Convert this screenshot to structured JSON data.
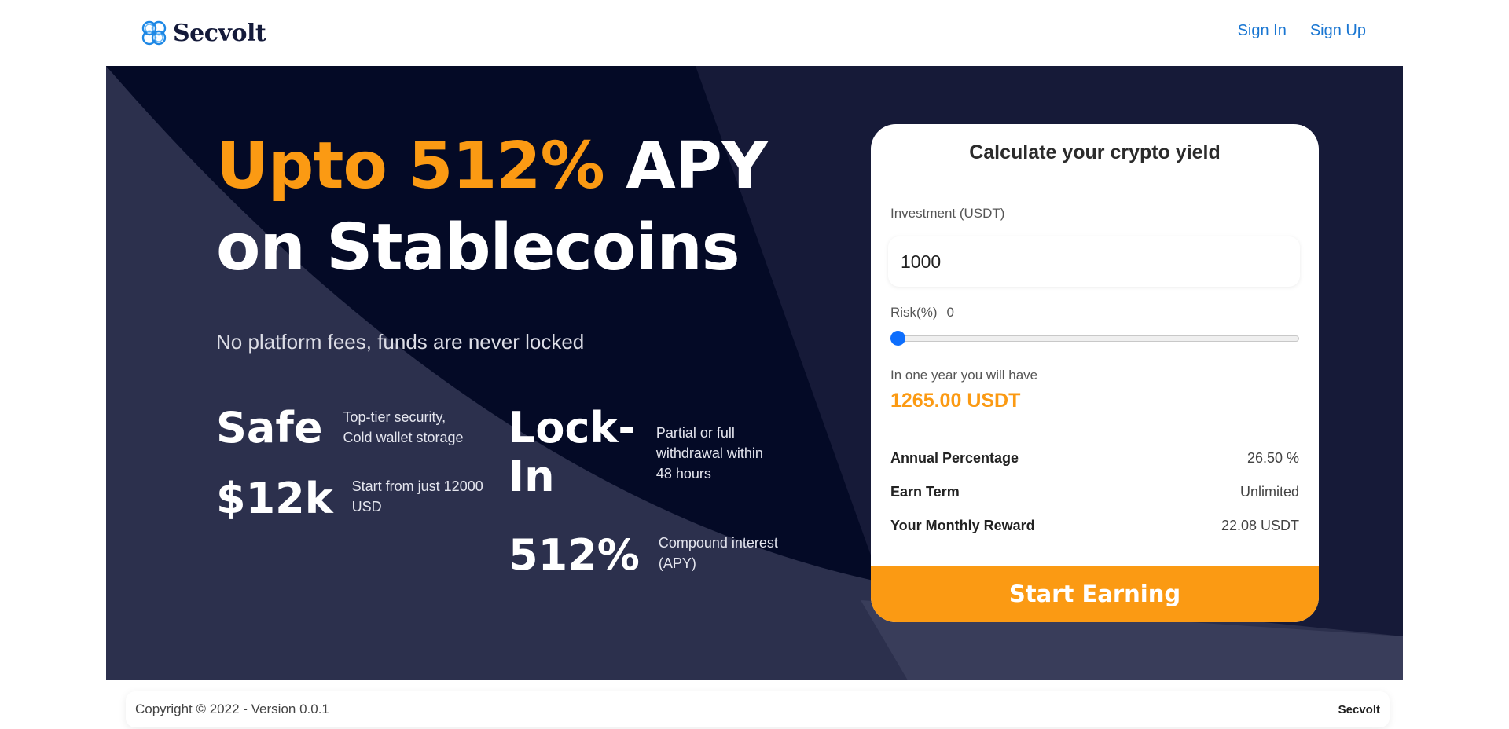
{
  "header": {
    "brand": "Secvolt",
    "nav": {
      "sign_in": "Sign In",
      "sign_up": "Sign Up"
    }
  },
  "hero": {
    "headline_accent": "Upto 512%",
    "headline_rest": "APY",
    "headline_line2": "on Stablecoins",
    "subline": "No platform fees, funds are never locked",
    "features": {
      "safe": {
        "title": "Safe",
        "line1": "Top-tier security,",
        "line2": "Cold wallet storage"
      },
      "min": {
        "title": "$12k",
        "line1": "Start from just 12000",
        "line2": "USD"
      },
      "lockin": {
        "title_line1": "Lock-",
        "title_line2": "In",
        "line1": "Partial or full",
        "line2": "withdrawal within",
        "line3": "48 hours"
      },
      "apy": {
        "title": "512%",
        "line1": "Compound interest",
        "line2": "(APY)"
      }
    }
  },
  "calculator": {
    "title": "Calculate your crypto yield",
    "investment_label": "Investment (USDT)",
    "investment_value": "1000",
    "risk_label": "Risk(%)",
    "risk_value": "0",
    "risk_level": 0,
    "result_label": "In one year you will have",
    "result_value": "1265.00 USDT",
    "rows": {
      "annual": {
        "label": "Annual Percentage",
        "value": "26.50 %"
      },
      "term": {
        "label": "Earn Term",
        "value": "Unlimited"
      },
      "monthly": {
        "label": "Your Monthly Reward",
        "value": "22.08 USDT"
      }
    },
    "cta": "Start Earning"
  },
  "footer": {
    "copyright": "Copyright © 2022 - Version 0.0.1",
    "brand": "Secvolt"
  },
  "colors": {
    "accent": "#fb9a13",
    "hero_bg": "#161a38",
    "link": "#1976d2",
    "slider_thumb": "#0d6efd"
  }
}
